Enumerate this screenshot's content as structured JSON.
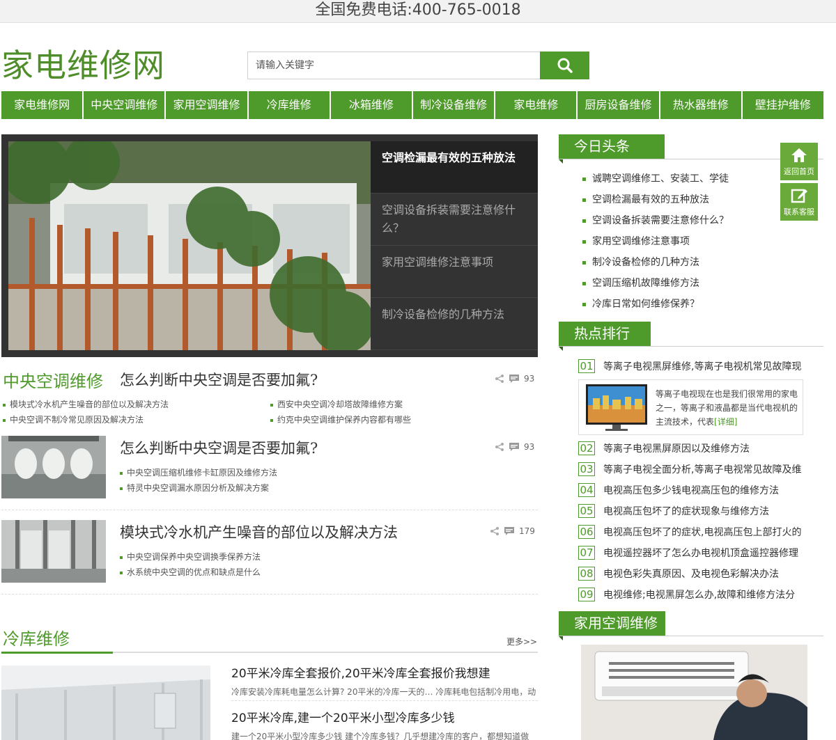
{
  "topbar": {
    "hotline": "全国免费电话:400-765-0018"
  },
  "header": {
    "logo": "家电维修网",
    "search_placeholder": "请输入关键字"
  },
  "nav": [
    "家电维修网",
    "中央空调维修",
    "家用空调维修",
    "冷库维修",
    "冰箱维修",
    "制冷设备维修",
    "家电维修",
    "厨房设备维修",
    "热水器维修",
    "壁挂护维修"
  ],
  "slider": {
    "items": [
      "空调检漏最有效的五种放法",
      "空调设备拆装需要注意修什么？",
      "家用空调维修注意事项",
      "制冷设备检修的几种方法"
    ]
  },
  "central_ac": {
    "title": "中央空调维修",
    "lead": {
      "title": "怎么判断中央空调是否要加氟?",
      "count": "93",
      "links": [
        "模块式冷水机产生噪音的部位以及解决方法",
        "西安中央空调冷却塔故障维修方案",
        "中央空调不制冷常见原因及解决方法",
        "约克中央空调维护保养内容都有哪些"
      ]
    },
    "articles": [
      {
        "title": "怎么判断中央空调是否要加氟?",
        "count": "93",
        "links": [
          "中央空调压缩机维修卡缸原因及维修方法",
          "特灵中央空调漏水原因分析及解决方案"
        ]
      },
      {
        "title": "模块式冷水机产生噪音的部位以及解决方法",
        "count": "179",
        "links": [
          "中央空调保养中央空调换季保养方法",
          "水系统中央空调的优点和缺点是什么"
        ]
      }
    ]
  },
  "cold_storage": {
    "title": "冷库维修",
    "more": "更多>>",
    "items": [
      {
        "title": "20平米冷库全套报价,20平米冷库全套报价我想建",
        "desc": "冷库安装冷库耗电量怎么计算? 20平米的冷库一天的… 冷库耗电包括制冷用电，动"
      },
      {
        "title": "20平米冷库,建一个20平米小型冷库多少钱",
        "desc": "建一个20平米小型冷库多少钱 建个冷库多钱？几乎想建冷库的客户，都想知道做"
      }
    ]
  },
  "sidebar": {
    "today": {
      "title": "今日头条",
      "items": [
        "诚聘空调维修工、安装工、学徒",
        "空调检漏最有效的五种放法",
        "空调设备拆装需要注意修什么？",
        "家用空调维修注意事项",
        "制冷设备检修的几种方法",
        "空调压缩机故障维修方法",
        "冷库日常如何维修保养？"
      ]
    },
    "hot": {
      "title": "热点排行",
      "card_desc": "等离子电视现在也是我们很常用的家电之一，等离子和液晶都是当代电视机的主流技术，代表",
      "card_detail": "[详细]",
      "items": [
        {
          "num": "01",
          "text": "等离子电视黑屏维修,等离子电视机常见故障现"
        },
        {
          "num": "02",
          "text": "等离子电视黑屏原因以及维修方法"
        },
        {
          "num": "03",
          "text": "等离子电视全面分析,等离子电视常见故障及维"
        },
        {
          "num": "04",
          "text": "电视高压包多少钱电视高压包的维修方法"
        },
        {
          "num": "05",
          "text": "电视高压包坏了的症状现象与维修方法"
        },
        {
          "num": "06",
          "text": "电视高压包坏了的症状,电视高压包上部打火的"
        },
        {
          "num": "07",
          "text": "电视遥控器坏了怎么办电视机顶盒遥控器修理"
        },
        {
          "num": "08",
          "text": "电视色彩失真原因、及电视色彩解决办法"
        },
        {
          "num": "09",
          "text": "电视维修;电视黑屏怎么办,故障和维修方法分"
        }
      ]
    },
    "home_ac": {
      "title": "家用空调维修"
    }
  },
  "float": {
    "home": "返回首页",
    "service": "联系客服"
  },
  "colors": {
    "brand_green": "#4e9a2a",
    "slider_bg": "#333333"
  }
}
